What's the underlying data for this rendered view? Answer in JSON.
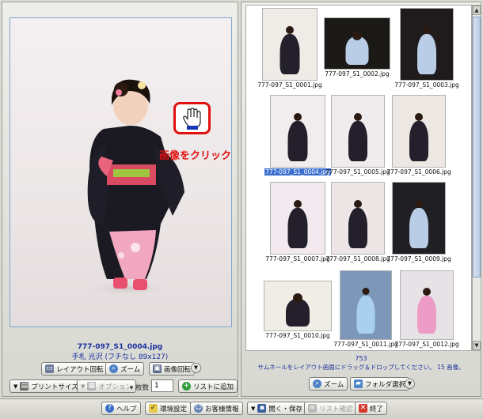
{
  "preview": {
    "filename": "777-097_S1_0004.jpg",
    "info": "手札 光沢 (フチなし 89x127)",
    "click_hint": "画像をクリック"
  },
  "left_toolbar": {
    "layout_rotate": "レイアウト回転",
    "zoom": "ズーム",
    "image_rotate": "画像回転",
    "print_size": "プリントサイズ",
    "option": "オプション",
    "copies_label": "▾ 枚数",
    "copies_value": "1",
    "add_to_list": "リストに追加"
  },
  "thumbnails": [
    {
      "caption": "777-097_S1_0001.jpg",
      "bg": "#efece8",
      "dark": false
    },
    {
      "caption": "777-097_S1_0002.jpg",
      "bg": "#1b1916",
      "dark": true
    },
    {
      "caption": "777-097_S1_0003.jpg",
      "bg": "#1f1b1c",
      "dark": true
    },
    {
      "caption": "777-097_S1_0004.jpg",
      "bg": "#f1ecee",
      "dark": false,
      "selected": true
    },
    {
      "caption": "777-097_S1_0005.jpg",
      "bg": "#f0ebed",
      "dark": false
    },
    {
      "caption": "777-097_S1_0006.jpg",
      "bg": "#ede8e4",
      "dark": false
    },
    {
      "caption": "777-097_S1_0007.jpg",
      "bg": "#f3eaf0",
      "dark": false
    },
    {
      "caption": "777-097_S1_0008.jpg",
      "bg": "#eee6e6",
      "dark": false
    },
    {
      "caption": "777-097_S1_0009.jpg",
      "bg": "#202024",
      "dark": true
    },
    {
      "caption": "777-097_S1_0010.jpg",
      "bg": "#f0ede6",
      "dark": false
    },
    {
      "caption": "777-097_S1_0011.jpg",
      "bg": "#7d97b8",
      "dark": true
    },
    {
      "caption": "777-097_S1_0012.jpg",
      "bg": "#e6e2e6",
      "dark": false
    }
  ],
  "right_panel": {
    "count": "753",
    "drag_hint": "サムネールをレイアウト画面にドラッグ＆ドロップしてください。 15 画像。",
    "zoom": "ズーム",
    "folder_select": "フォルダ選択"
  },
  "bottom_bar": {
    "help": "ヘルプ",
    "settings": "環境設定",
    "customer_info": "お客様情報",
    "open_save": "開く・保存",
    "list_confirm": "リスト確認",
    "exit": "終了"
  },
  "colors": {
    "accent_red": "#e01010",
    "link_blue": "#1a2f9e",
    "selection_blue": "#3b6fcf"
  }
}
